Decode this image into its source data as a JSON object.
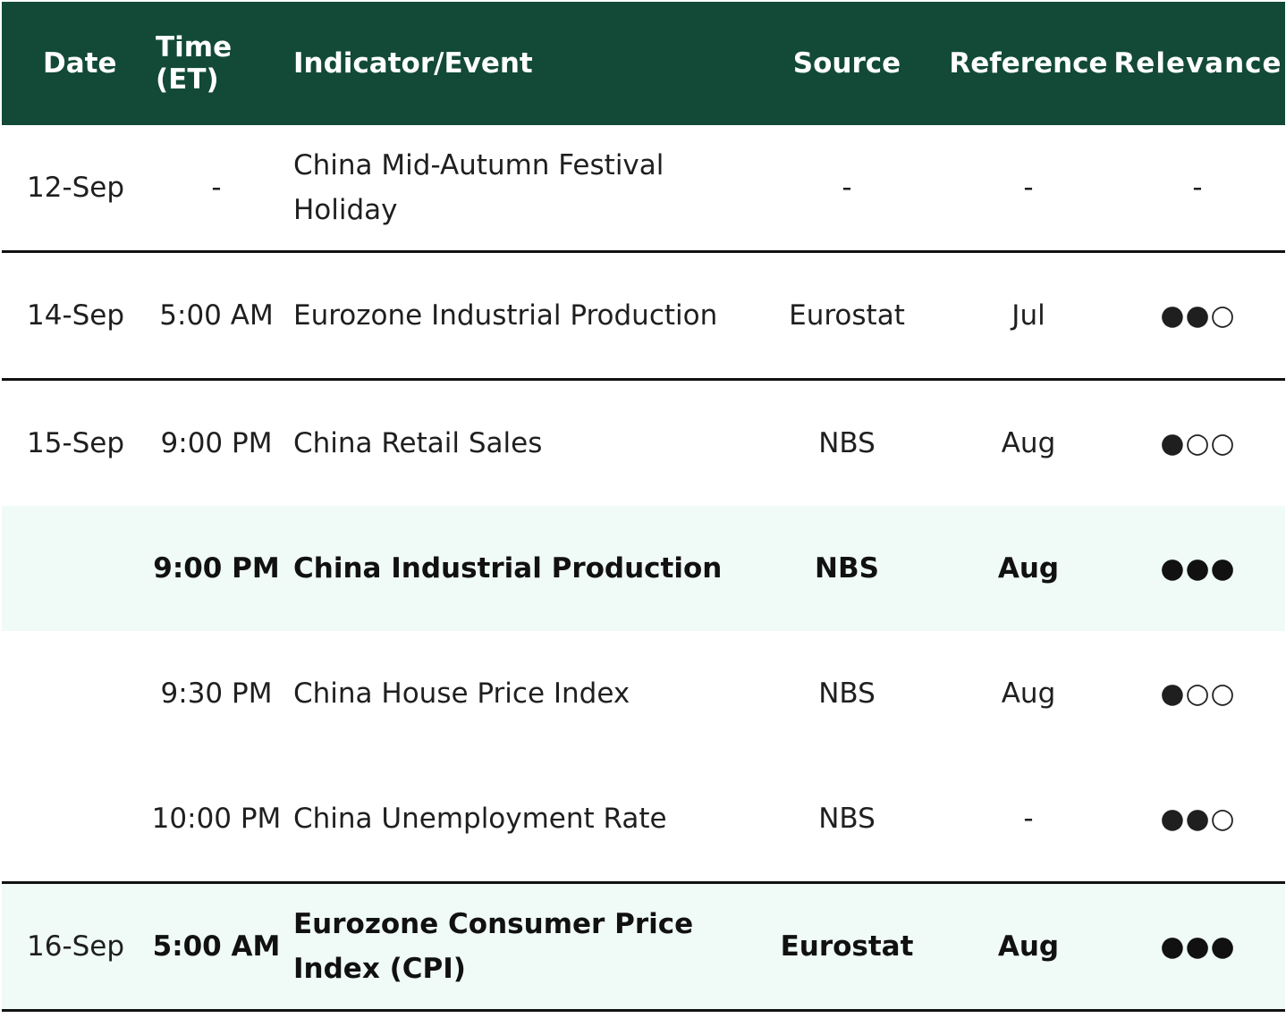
{
  "header": {
    "date": "Date",
    "time": "Time (ET)",
    "event": "Indicator/Event",
    "source": "Source",
    "reference": "Reference",
    "relevance": "Relevance"
  },
  "rows": [
    {
      "date": "12-Sep",
      "time": "-",
      "event": "China Mid-Autumn Festival Holiday",
      "source": "-",
      "reference": "-",
      "relevance": "-"
    },
    {
      "date": "14-Sep",
      "time": "5:00 AM",
      "event": "Eurozone Industrial Production",
      "source": "Eurostat",
      "reference": "Jul",
      "relevance": "●●○"
    },
    {
      "date": "15-Sep",
      "time": "9:00 PM",
      "event": "China Retail Sales",
      "source": "NBS",
      "reference": "Aug",
      "relevance": "●○○"
    },
    {
      "date": "",
      "time": "9:00 PM",
      "event": "China Industrial Production",
      "source": "NBS",
      "reference": "Aug",
      "relevance": "●●●"
    },
    {
      "date": "",
      "time": "9:30 PM",
      "event": "China House Price Index",
      "source": "NBS",
      "reference": "Aug",
      "relevance": "●○○"
    },
    {
      "date": "",
      "time": "10:00 PM",
      "event": "China Unemployment Rate",
      "source": "NBS",
      "reference": "-",
      "relevance": "●●○"
    },
    {
      "date": "16-Sep",
      "time": "5:00 AM",
      "event": "Eurozone Consumer Price Index (CPI)",
      "source": "Eurostat",
      "reference": "Aug",
      "relevance": "●●●"
    }
  ],
  "colors": {
    "header_bg": "#124a37",
    "highlight_bg": "#f0faf6"
  }
}
